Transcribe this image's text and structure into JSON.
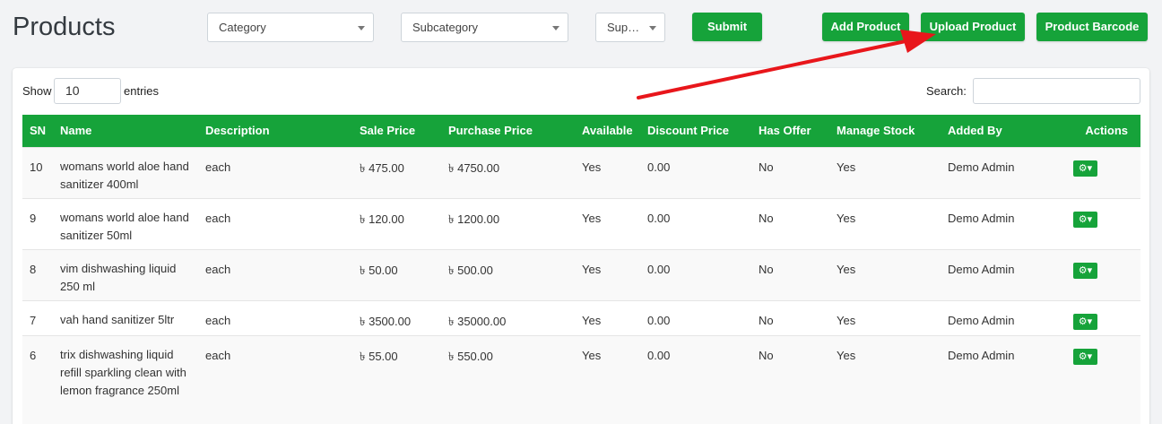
{
  "page": {
    "title": "Products"
  },
  "filters": {
    "category": "Category",
    "subcategory": "Subcategory",
    "supplier": "Sup…"
  },
  "buttons": {
    "submit": "Submit",
    "add_product": "Add Product",
    "upload_product": "Upload Product",
    "product_barcode": "Product Barcode"
  },
  "table_controls": {
    "show_label": "Show",
    "entries_value": "10",
    "entries_label": "entries",
    "search_label": "Search:"
  },
  "table": {
    "headers": [
      "SN",
      "Name",
      "Description",
      "Sale Price",
      "Purchase Price",
      "Available",
      "Discount Price",
      "Has Offer",
      "Manage Stock",
      "Added By",
      "Actions"
    ],
    "rows": [
      {
        "sn": "10",
        "name": "womans world aloe hand sanitizer 400ml",
        "description": "each",
        "sale": "৳ 475.00",
        "purchase": "৳ 4750.00",
        "available": "Yes",
        "discount": "0.00",
        "offer": "No",
        "stock": "Yes",
        "added_by": "Demo Admin"
      },
      {
        "sn": "9",
        "name": "womans world aloe hand sanitizer 50ml",
        "description": "each",
        "sale": "৳ 120.00",
        "purchase": "৳ 1200.00",
        "available": "Yes",
        "discount": "0.00",
        "offer": "No",
        "stock": "Yes",
        "added_by": "Demo Admin"
      },
      {
        "sn": "8",
        "name": "vim dishwashing liquid 250 ml",
        "description": "each",
        "sale": "৳ 50.00",
        "purchase": "৳ 500.00",
        "available": "Yes",
        "discount": "0.00",
        "offer": "No",
        "stock": "Yes",
        "added_by": "Demo Admin"
      },
      {
        "sn": "7",
        "name": "vah hand sanitizer 5ltr",
        "description": "each",
        "sale": "৳ 3500.00",
        "purchase": "৳ 35000.00",
        "available": "Yes",
        "discount": "0.00",
        "offer": "No",
        "stock": "Yes",
        "added_by": "Demo Admin"
      },
      {
        "sn": "6",
        "name": "trix dishwashing liquid refill sparkling clean with lemon fragrance 250ml",
        "description": "each",
        "sale": "৳ 55.00",
        "purchase": "৳ 550.00",
        "available": "Yes",
        "discount": "0.00",
        "offer": "No",
        "stock": "Yes",
        "added_by": "Demo Admin"
      }
    ]
  },
  "icons": {
    "action": "gear-icon",
    "annotation": "red-arrow"
  },
  "colors": {
    "accent": "#16a33a",
    "annotation": "#e8161b"
  }
}
